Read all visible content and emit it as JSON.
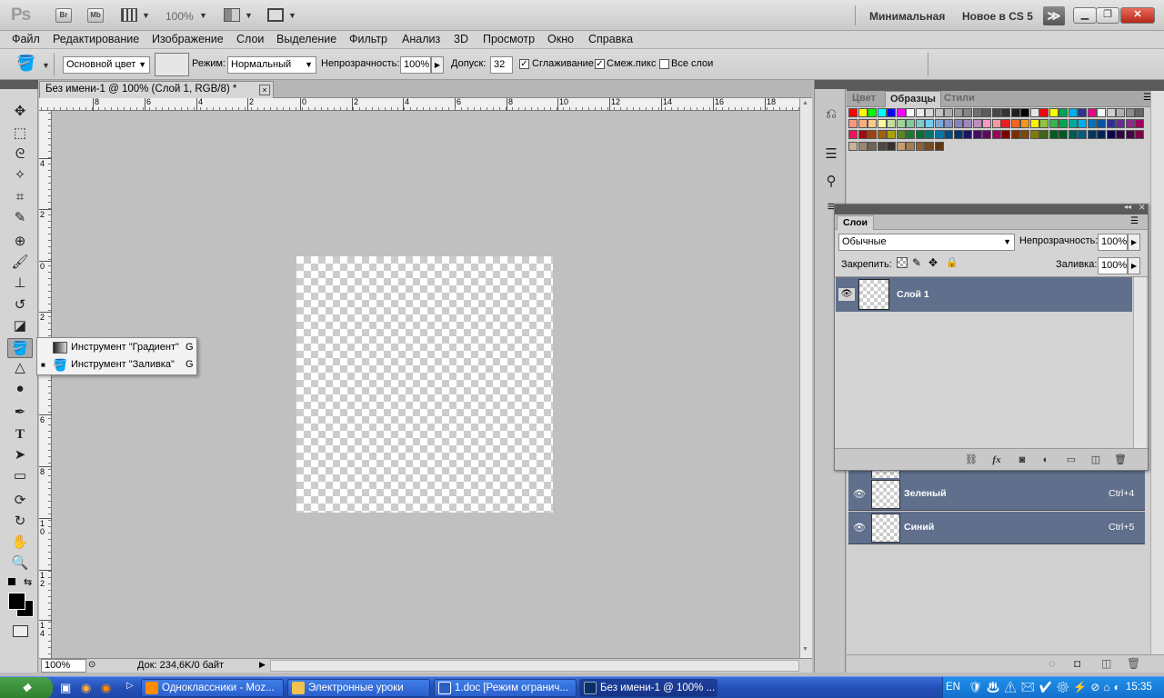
{
  "appbar": {
    "logo": "Ps",
    "bridge_label": "Br",
    "minibridge_label": "Mb",
    "zoom": "100%",
    "workspace_minimal": "Минимальная",
    "workspace_new_cs5": "Новое в CS 5",
    "more_label": "≫"
  },
  "menu": [
    "Файл",
    "Редактирование",
    "Изображение",
    "Слои",
    "Выделение",
    "Фильтр",
    "Анализ",
    "3D",
    "Просмотр",
    "Окно",
    "Справка"
  ],
  "options": {
    "fill_source": "Основной цвет",
    "mode_label": "Режим:",
    "mode_value": "Нормальный",
    "opacity_label": "Непрозрачность:",
    "opacity_value": "100%",
    "tolerance_label": "Допуск:",
    "tolerance_value": "32",
    "antialias_label": "Сглаживание",
    "antialias_checked": true,
    "contiguous_label": "Смеж.пикс",
    "contiguous_checked": true,
    "all_layers_label": "Все слои",
    "all_layers_checked": false
  },
  "document": {
    "tab_title": "Без имени-1 @ 100% (Слой 1, RGB/8) *",
    "close": "×",
    "status_zoom": "100%",
    "status_doc": "Док: 234,6K/0 байт"
  },
  "ruler_top_labels": [
    "8",
    "6",
    "4",
    "2",
    "0",
    "2",
    "4",
    "6",
    "8",
    "10",
    "12",
    "14",
    "16",
    "18"
  ],
  "ruler_left_labels": [
    "4",
    "2",
    "0",
    "2",
    "4",
    "6",
    "8",
    "1\n0",
    "1\n2",
    "1\n4"
  ],
  "flyout": [
    {
      "label": "Инструмент \"Градиент\"",
      "shortcut": "G",
      "active": false
    },
    {
      "label": "Инструмент \"Заливка\"",
      "shortcut": "G",
      "active": true
    }
  ],
  "panels": {
    "tabs": [
      "Цвет",
      "Образцы",
      "Стили"
    ],
    "active_tab": "Образцы",
    "swatch_colors": [
      "#ff0000",
      "#ffff00",
      "#00ff00",
      "#00ffff",
      "#0000ff",
      "#ff00ff",
      "#ffffff",
      "#ebebeb",
      "#d6d6d6",
      "#c2c2c2",
      "#adadad",
      "#999999",
      "#858585",
      "#707070",
      "#5c5c5c",
      "#474747",
      "#333333",
      "#1f1f1f",
      "#000000",
      "#e4e4e4",
      "#ff0000",
      "#ffff00",
      "#00a651",
      "#00aeef",
      "#2e3192",
      "#ec008c",
      "#ffffff",
      "#cfcfcf",
      "#b0b0b0",
      "#8c8c8c",
      "#666666",
      "#f7977a",
      "#f9ad81",
      "#fdc68a",
      "#fff79a",
      "#c4df9b",
      "#a3d39c",
      "#82ca9d",
      "#7bcdc8",
      "#6ecff6",
      "#7ea7d8",
      "#8493ca",
      "#8882be",
      "#a187be",
      "#bc8dbf",
      "#f49ac2",
      "#f6989d",
      "#ed1c24",
      "#f26522",
      "#f7941d",
      "#fff200",
      "#8dc63f",
      "#39b54a",
      "#00a651",
      "#00a99d",
      "#00aeef",
      "#0072bc",
      "#0054a6",
      "#2e3192",
      "#662d91",
      "#92278f",
      "#9e005d",
      "#ed145b",
      "#9e0b0f",
      "#a0410d",
      "#a3620a",
      "#aba000",
      "#598527",
      "#1a7b30",
      "#007236",
      "#00746b",
      "#0076a3",
      "#004b80",
      "#003471",
      "#1b1464",
      "#440e62",
      "#630460",
      "#9e005d",
      "#790000",
      "#7b2e00",
      "#7d4900",
      "#827b00",
      "#406618",
      "#005e20",
      "#005826",
      "#005952",
      "#005b7f",
      "#003663",
      "#002157",
      "#0d004c",
      "#32004b",
      "#4b0049",
      "#7b0046",
      "#c7b299",
      "#998675",
      "#736357",
      "#534741",
      "#37302d",
      "#c69c6d",
      "#a67c52",
      "#8c6239",
      "#754c24",
      "#603913"
    ],
    "layers_tab": "Слои",
    "blend_mode": "Обычные",
    "opacity_label": "Непрозрачность:",
    "opacity_value": "100%",
    "lock_label": "Закрепить:",
    "fill_label": "Заливка:",
    "fill_value": "100%",
    "layer_name": "Слой 1",
    "channels": [
      {
        "name": "Зеленый",
        "shortcut": "Ctrl+4"
      },
      {
        "name": "Синий",
        "shortcut": "Ctrl+5"
      }
    ]
  },
  "taskbar": {
    "tasks": [
      {
        "label": "Одноклассники - Moz...",
        "color": "#ff8a00"
      },
      {
        "label": "Электронные уроки",
        "color": "#f2c14e"
      },
      {
        "label": "1.doc [Режим огранич...",
        "color": "#2b5fc2"
      },
      {
        "label": "Без имени-1 @ 100% ...",
        "color": "#0b2e66"
      }
    ],
    "lang": "EN",
    "clock": "15:35"
  }
}
